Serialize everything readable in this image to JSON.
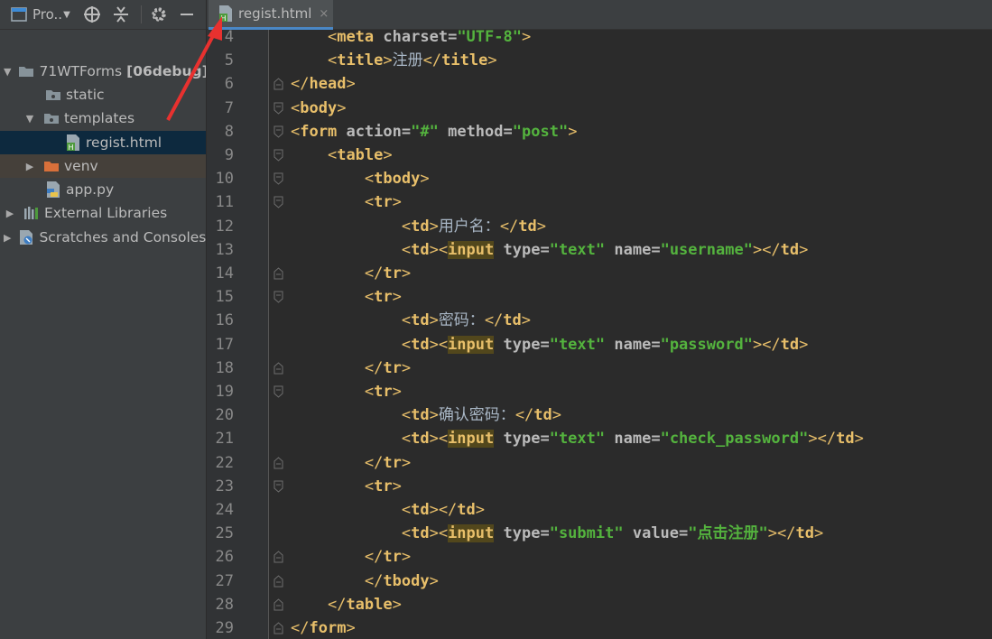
{
  "project_panel": {
    "title": "Pro..",
    "tree": [
      {
        "label": "71WTForms",
        "suffix": "[06debug]",
        "type": "project-root",
        "expanded": true
      },
      {
        "label": "static",
        "type": "folder",
        "expanded": false
      },
      {
        "label": "templates",
        "type": "folder",
        "expanded": true
      },
      {
        "label": "regist.html",
        "type": "html-file",
        "selected": true
      },
      {
        "label": "venv",
        "type": "excluded-folder",
        "expanded": false
      },
      {
        "label": "app.py",
        "type": "python-file"
      },
      {
        "label": "External Libraries",
        "type": "libraries",
        "expanded": false
      },
      {
        "label": "Scratches and Consoles",
        "type": "scratches",
        "expanded": false
      }
    ]
  },
  "editor": {
    "tab": {
      "label": "regist.html",
      "close": "×"
    },
    "lines": [
      {
        "n": "4",
        "text": "    <meta charset=\"UTF-8\">"
      },
      {
        "n": "5",
        "text": "    <title>注册</title>"
      },
      {
        "n": "6",
        "text": "</head>"
      },
      {
        "n": "7",
        "text": "<body>"
      },
      {
        "n": "8",
        "text": "<form action=\"#\" method=\"post\">"
      },
      {
        "n": "9",
        "text": "    <table>"
      },
      {
        "n": "10",
        "text": "        <tbody>"
      },
      {
        "n": "11",
        "text": "        <tr>"
      },
      {
        "n": "12",
        "text": "            <td>用户名：</td>"
      },
      {
        "n": "13",
        "text": "            <td><input type=\"text\" name=\"username\"></td>"
      },
      {
        "n": "14",
        "text": "        </tr>"
      },
      {
        "n": "15",
        "text": "        <tr>"
      },
      {
        "n": "16",
        "text": "            <td>密码：</td>"
      },
      {
        "n": "17",
        "text": "            <td><input type=\"text\" name=\"password\"></td>"
      },
      {
        "n": "18",
        "text": "        </tr>"
      },
      {
        "n": "19",
        "text": "        <tr>"
      },
      {
        "n": "20",
        "text": "            <td>确认密码：</td>"
      },
      {
        "n": "21",
        "text": "            <td><input type=\"text\" name=\"check_password\"></td>"
      },
      {
        "n": "22",
        "text": "        </tr>"
      },
      {
        "n": "23",
        "text": "        <tr>"
      },
      {
        "n": "24",
        "text": "            <td></td>"
      },
      {
        "n": "25",
        "text": "            <td><input type=\"submit\" value=\"点击注册\"></td>"
      },
      {
        "n": "26",
        "text": "        </tr>"
      },
      {
        "n": "27",
        "text": "        </tbody>"
      },
      {
        "n": "28",
        "text": "    </table>"
      },
      {
        "n": "29",
        "text": "</form>"
      }
    ]
  },
  "colors": {
    "tag": "#e8bf6a",
    "attribute": "#bababa",
    "string": "#54b33e",
    "text": "#a9b7c6",
    "highlight": "#52471c",
    "annotation_arrow": "#e8312f"
  },
  "icons": [
    "project-view-icon",
    "dropdown-icon",
    "locate-icon",
    "collapse-icon",
    "gear-icon",
    "minimize-icon",
    "folder-icon",
    "html-file-icon",
    "python-file-icon",
    "libraries-icon",
    "scratches-icon",
    "close-icon",
    "fold-marker-icon"
  ]
}
